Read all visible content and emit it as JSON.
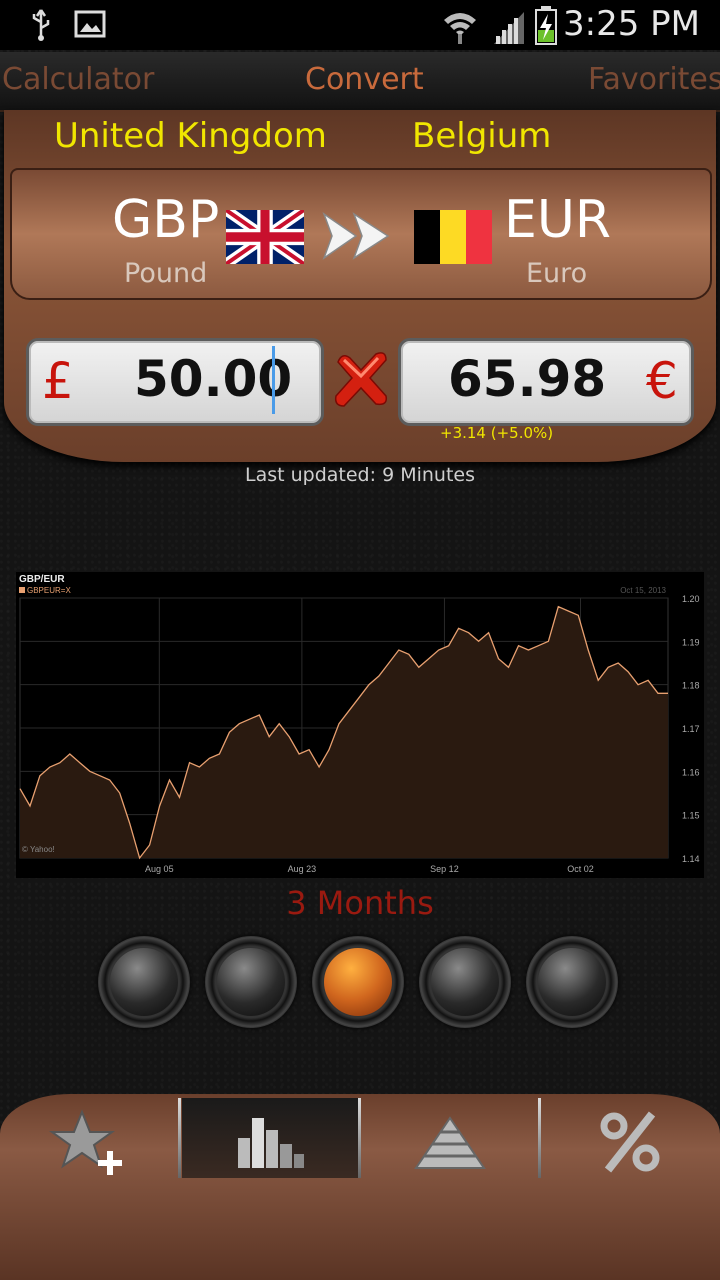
{
  "status_bar": {
    "time": "3:25 PM",
    "icons": [
      "usb-icon",
      "image-icon",
      "wifi-icon",
      "signal-icon",
      "battery-charging-icon"
    ]
  },
  "top_tabs": [
    {
      "label": "Calculator",
      "active": false
    },
    {
      "label": "Convert",
      "active": true
    },
    {
      "label": "Favorites",
      "active": false
    }
  ],
  "conversion": {
    "from": {
      "country": "United Kingdom",
      "code": "GBP",
      "name": "Pound",
      "symbol": "£",
      "amount": "50.00",
      "flag": "uk-flag-icon"
    },
    "to": {
      "country": "Belgium",
      "code": "EUR",
      "name": "Euro",
      "symbol": "€",
      "amount": "65.98",
      "flag": "belgium-flag-icon"
    },
    "change": "+3.14  (+5.0%)",
    "last_updated": "Last updated: 9 Minutes"
  },
  "chart_data": {
    "type": "area",
    "title": "GBP/EUR",
    "legend": "GBPEUR=X",
    "date": "Oct 15, 2013",
    "credit": "© Yahoo!",
    "x_tick_labels": [
      "Aug 05",
      "Aug 23",
      "Sep 12",
      "Oct 02"
    ],
    "y_tick_labels": [
      "1.20",
      "1.19",
      "1.18",
      "1.17",
      "1.16",
      "1.15",
      "1.14"
    ],
    "ylim": [
      1.14,
      1.2
    ],
    "values": [
      1.156,
      1.152,
      1.159,
      1.161,
      1.162,
      1.164,
      1.162,
      1.16,
      1.159,
      1.158,
      1.155,
      1.148,
      1.14,
      1.143,
      1.152,
      1.158,
      1.154,
      1.162,
      1.161,
      1.163,
      1.164,
      1.169,
      1.171,
      1.172,
      1.173,
      1.168,
      1.171,
      1.168,
      1.164,
      1.165,
      1.161,
      1.165,
      1.171,
      1.174,
      1.177,
      1.18,
      1.182,
      1.185,
      1.188,
      1.187,
      1.184,
      1.186,
      1.188,
      1.189,
      1.193,
      1.192,
      1.19,
      1.192,
      1.186,
      1.184,
      1.189,
      1.188,
      1.189,
      1.19,
      1.198,
      1.197,
      1.196,
      1.188,
      1.181,
      1.184,
      1.185,
      1.183,
      1.18,
      1.181,
      1.178,
      1.178
    ],
    "grid": true,
    "color": "#e8a070"
  },
  "period": {
    "label": "3 Months",
    "buttons": 5,
    "active_index": 2
  },
  "bottom_tabs": [
    {
      "name": "add-favorite-icon",
      "active": false
    },
    {
      "name": "chart-icon",
      "active": true
    },
    {
      "name": "pyramid-icon",
      "active": false
    },
    {
      "name": "percent-icon",
      "active": false
    }
  ]
}
